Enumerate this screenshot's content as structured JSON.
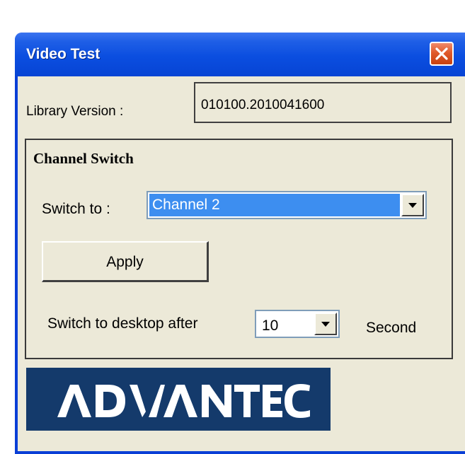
{
  "window": {
    "title": "Video Test"
  },
  "library": {
    "label": "Library Version :",
    "value": "010100.2010041600"
  },
  "channel_switch": {
    "group_title": "Channel Switch",
    "switch_label": "Switch to :",
    "selected_channel": "Channel 2",
    "apply_label": "Apply"
  },
  "desktop_timer": {
    "label": "Switch to desktop after",
    "selected_seconds": "10",
    "unit_label": "Second"
  },
  "logo": {
    "text": "ADVANTECH"
  },
  "icons": {
    "close": "close-icon",
    "dropdown": "chevron-down-icon"
  },
  "colors": {
    "titlebar": "#0b4ee0",
    "close_button": "#e05a2b",
    "dialog_bg": "#ece9d8",
    "selection": "#3d8ef0",
    "logo_bg": "#143a6b"
  }
}
